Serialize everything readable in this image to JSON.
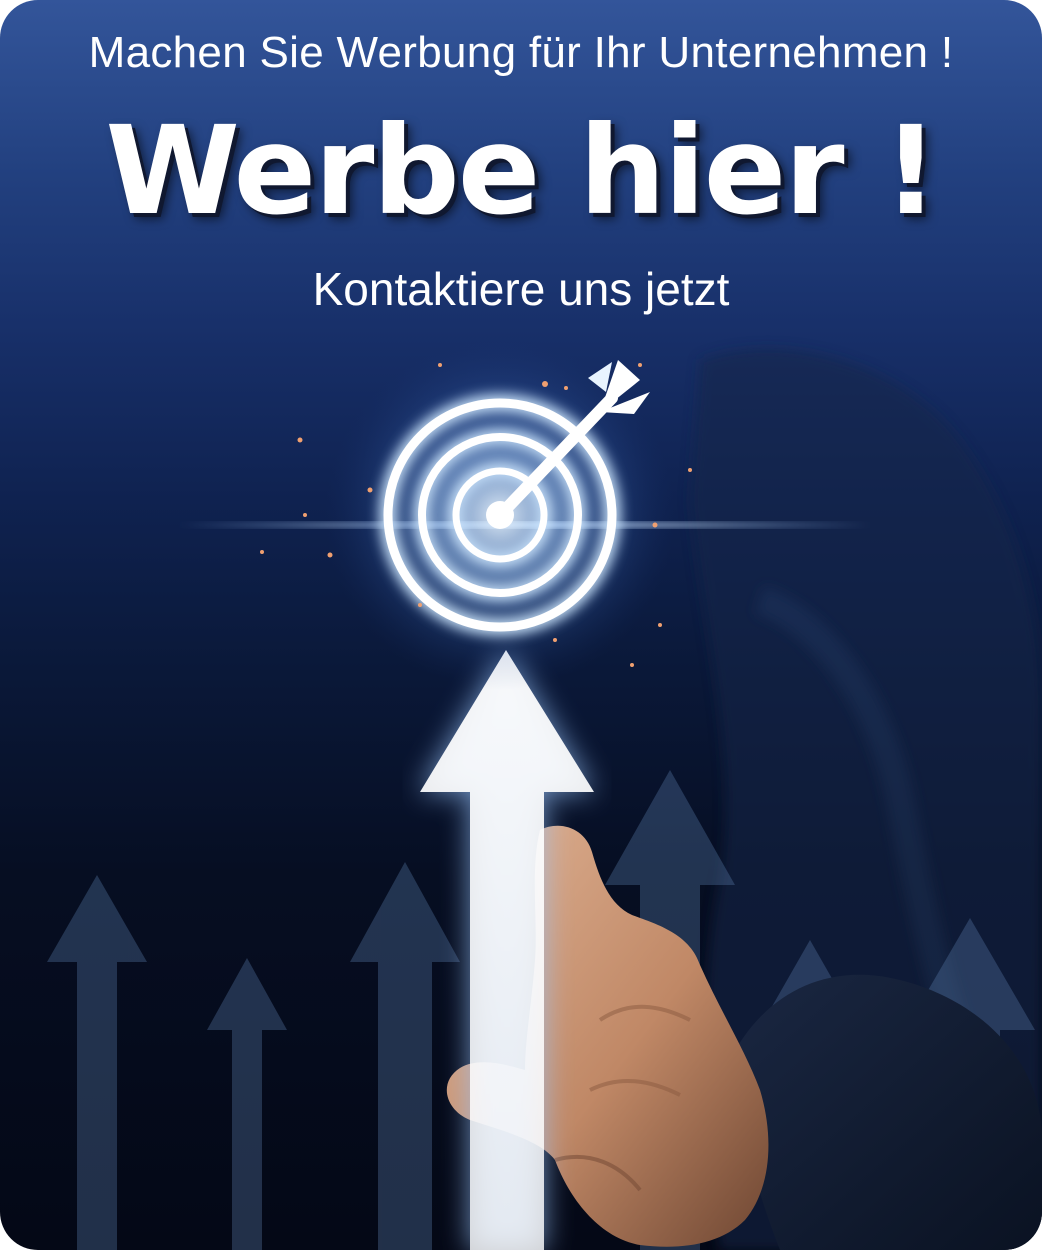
{
  "ad": {
    "tagline": "Machen Sie Werbung für Ihr Unternehmen !",
    "headline": "Werbe hier !",
    "subline": "Kontaktiere uns jetzt"
  },
  "colors": {
    "top_blue": "#33559a",
    "bottom_navy": "#040816",
    "glow": "#bfe0ff",
    "text": "#ffffff"
  },
  "icons": [
    "target-icon",
    "arrow-up-icon",
    "hand-image"
  ]
}
